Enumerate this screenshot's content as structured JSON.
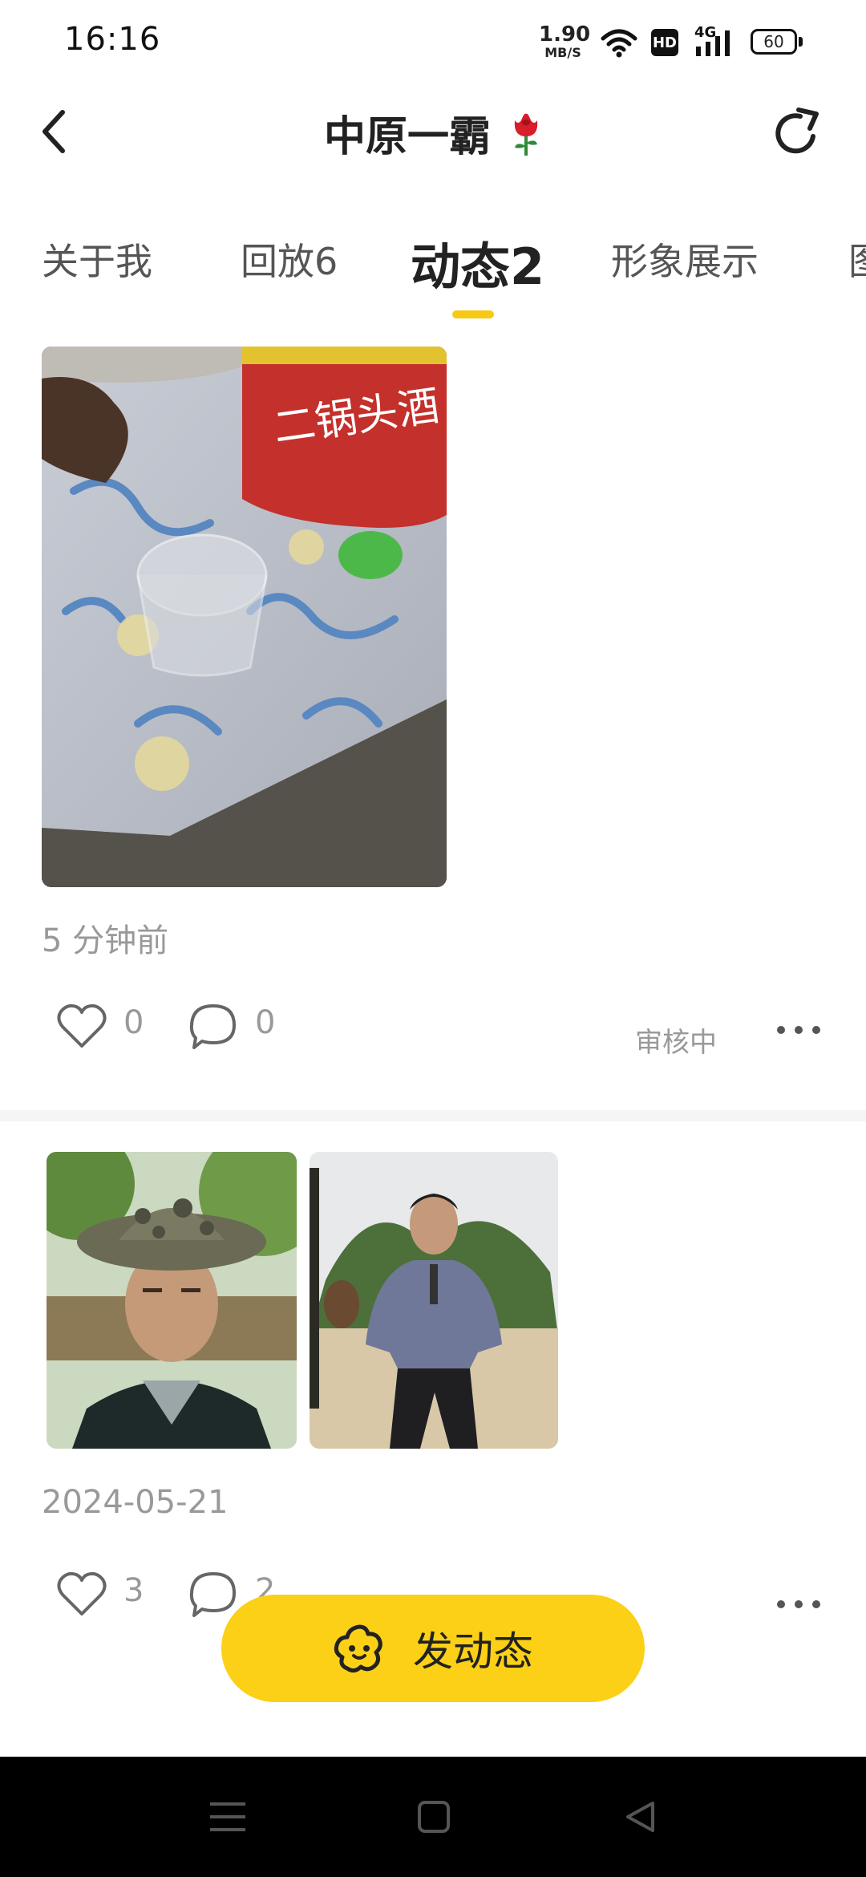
{
  "status_bar": {
    "time": "16:16",
    "speed_value": "1.90",
    "speed_unit": "MB/S",
    "hd": "HD",
    "network": "4G",
    "battery": "60"
  },
  "header": {
    "title": "中原一霸",
    "icons": [
      "back-arrow-icon",
      "rose-icon",
      "refresh-icon"
    ]
  },
  "tabs": [
    {
      "label": "关于我",
      "active": false
    },
    {
      "label": "回放6",
      "active": false
    },
    {
      "label": "动态2",
      "active": true
    },
    {
      "label": "形象展示",
      "active": false
    },
    {
      "label": "图",
      "active": false
    }
  ],
  "posts": [
    {
      "time": "5 分钟前",
      "likes": "0",
      "comments": "0",
      "status": "审核中",
      "photo_text": "二锅头酒"
    },
    {
      "time": "2024-05-21",
      "likes": "3",
      "comments": "2"
    }
  ],
  "compose_button": {
    "label": "发动态"
  },
  "colors": {
    "accent": "#fbd016",
    "tab_indicator": "#f9c812",
    "muted_text": "#999999",
    "rose_red": "#d81e2a",
    "rose_green": "#2e8b3a"
  }
}
